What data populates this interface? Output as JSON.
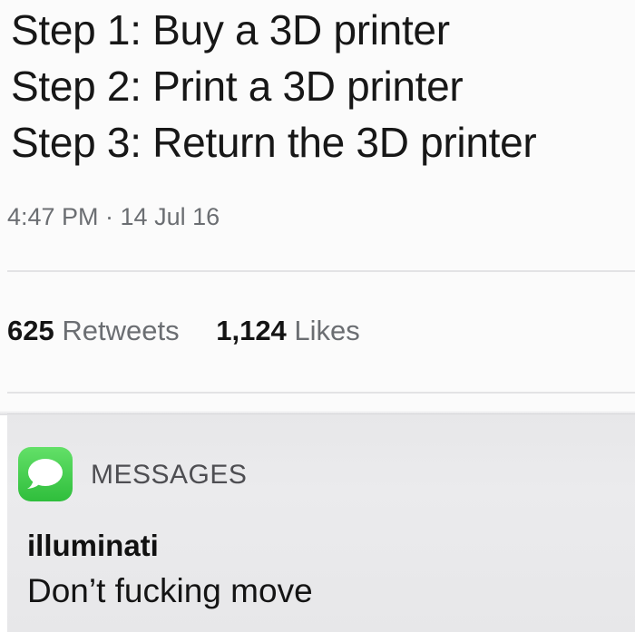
{
  "tweet": {
    "lines": [
      "Step 1: Buy a 3D printer",
      "Step 2: Print a 3D printer",
      "Step 3: Return the 3D printer"
    ],
    "timestamp": "4:47 PM · 14 Jul 16",
    "retweets_count": "625",
    "retweets_label": "Retweets",
    "likes_count": "1,124",
    "likes_label": "Likes"
  },
  "notification": {
    "app_icon": "messages-app-icon",
    "app_name": "MESSAGES",
    "sender": "illuminati",
    "message": "Don’t fucking move",
    "icon_color": "#34c23f"
  }
}
